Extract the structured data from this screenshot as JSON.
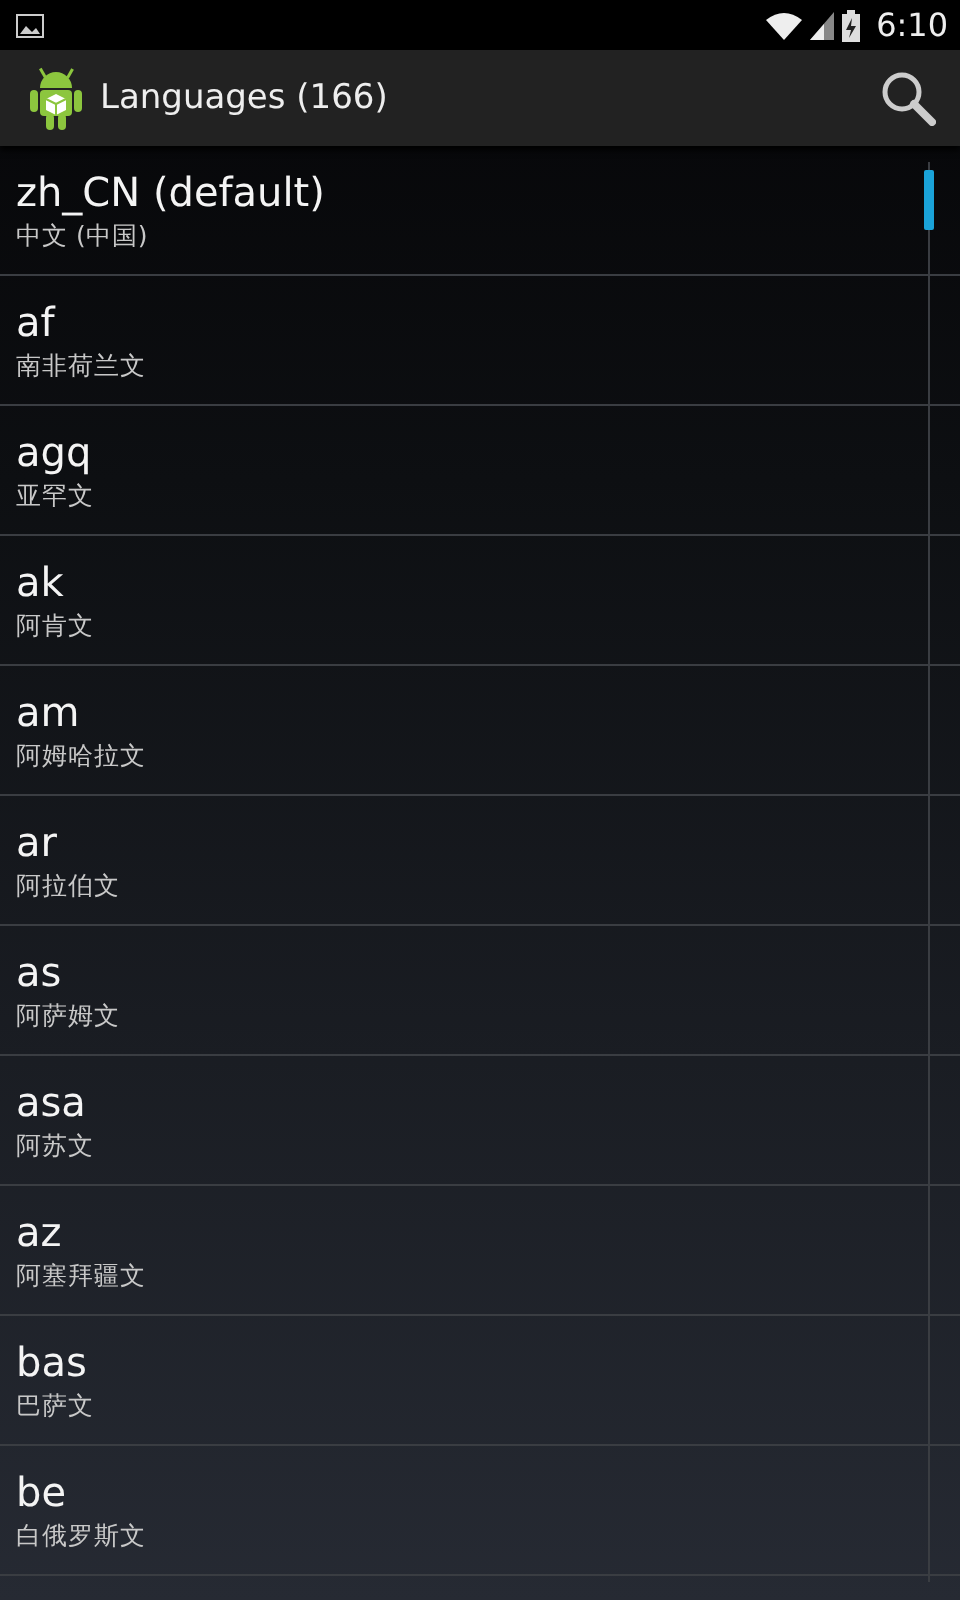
{
  "status_bar": {
    "time": "6:10"
  },
  "action_bar": {
    "title": "Languages (166)"
  },
  "languages": [
    {
      "code": "zh_CN (default)",
      "name": "中文 (中国)"
    },
    {
      "code": "af",
      "name": "南非荷兰文"
    },
    {
      "code": "agq",
      "name": "亚罕文"
    },
    {
      "code": "ak",
      "name": "阿肯文"
    },
    {
      "code": "am",
      "name": "阿姆哈拉文"
    },
    {
      "code": "ar",
      "name": "阿拉伯文"
    },
    {
      "code": "as",
      "name": "阿萨姆文"
    },
    {
      "code": "asa",
      "name": "阿苏文"
    },
    {
      "code": "az",
      "name": "阿塞拜疆文"
    },
    {
      "code": "bas",
      "name": "巴萨文"
    },
    {
      "code": "be",
      "name": "白俄罗斯文"
    }
  ]
}
